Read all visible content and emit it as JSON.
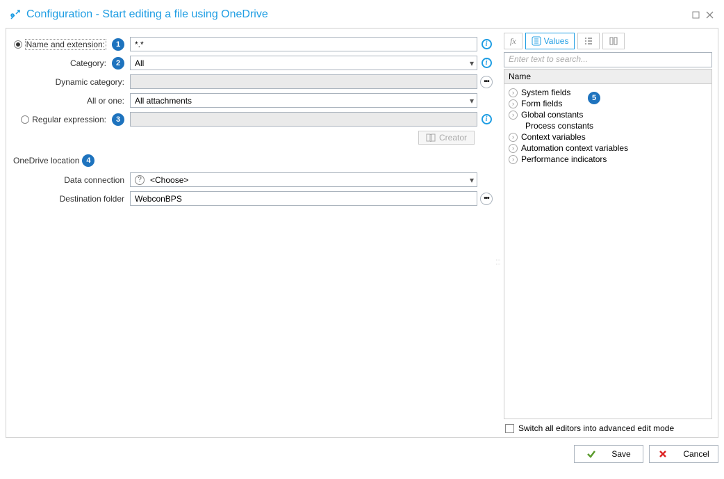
{
  "window": {
    "title": "Configuration - Start editing a file using OneDrive"
  },
  "form": {
    "name_ext": {
      "label": "Name and extension:",
      "value": "*.*"
    },
    "category": {
      "label": "Category:",
      "value": "All"
    },
    "dyn_category": {
      "label": "Dynamic category:",
      "value": ""
    },
    "all_or_one": {
      "label": "All or one:",
      "value": "All attachments"
    },
    "regex": {
      "label": "Regular expression:",
      "value": ""
    },
    "creator_btn": "Creator",
    "onedrive_section": "OneDrive location",
    "data_connection": {
      "label": "Data connection",
      "value": "<Choose>"
    },
    "dest_folder": {
      "label": "Destination folder",
      "value": "WebconBPS"
    }
  },
  "badges": {
    "b1": "1",
    "b2": "2",
    "b3": "3",
    "b4": "4",
    "b5": "5"
  },
  "side": {
    "tab_values": "Values",
    "search_placeholder": "Enter text to search...",
    "header": "Name",
    "items": {
      "system": "System fields",
      "form": "Form fields",
      "global": "Global constants",
      "process": "Process constants",
      "context": "Context variables",
      "auto": "Automation context variables",
      "perf": "Performance indicators"
    },
    "advanced_label": "Switch all editors into advanced edit mode"
  },
  "footer": {
    "save": "Save",
    "cancel": "Cancel"
  }
}
